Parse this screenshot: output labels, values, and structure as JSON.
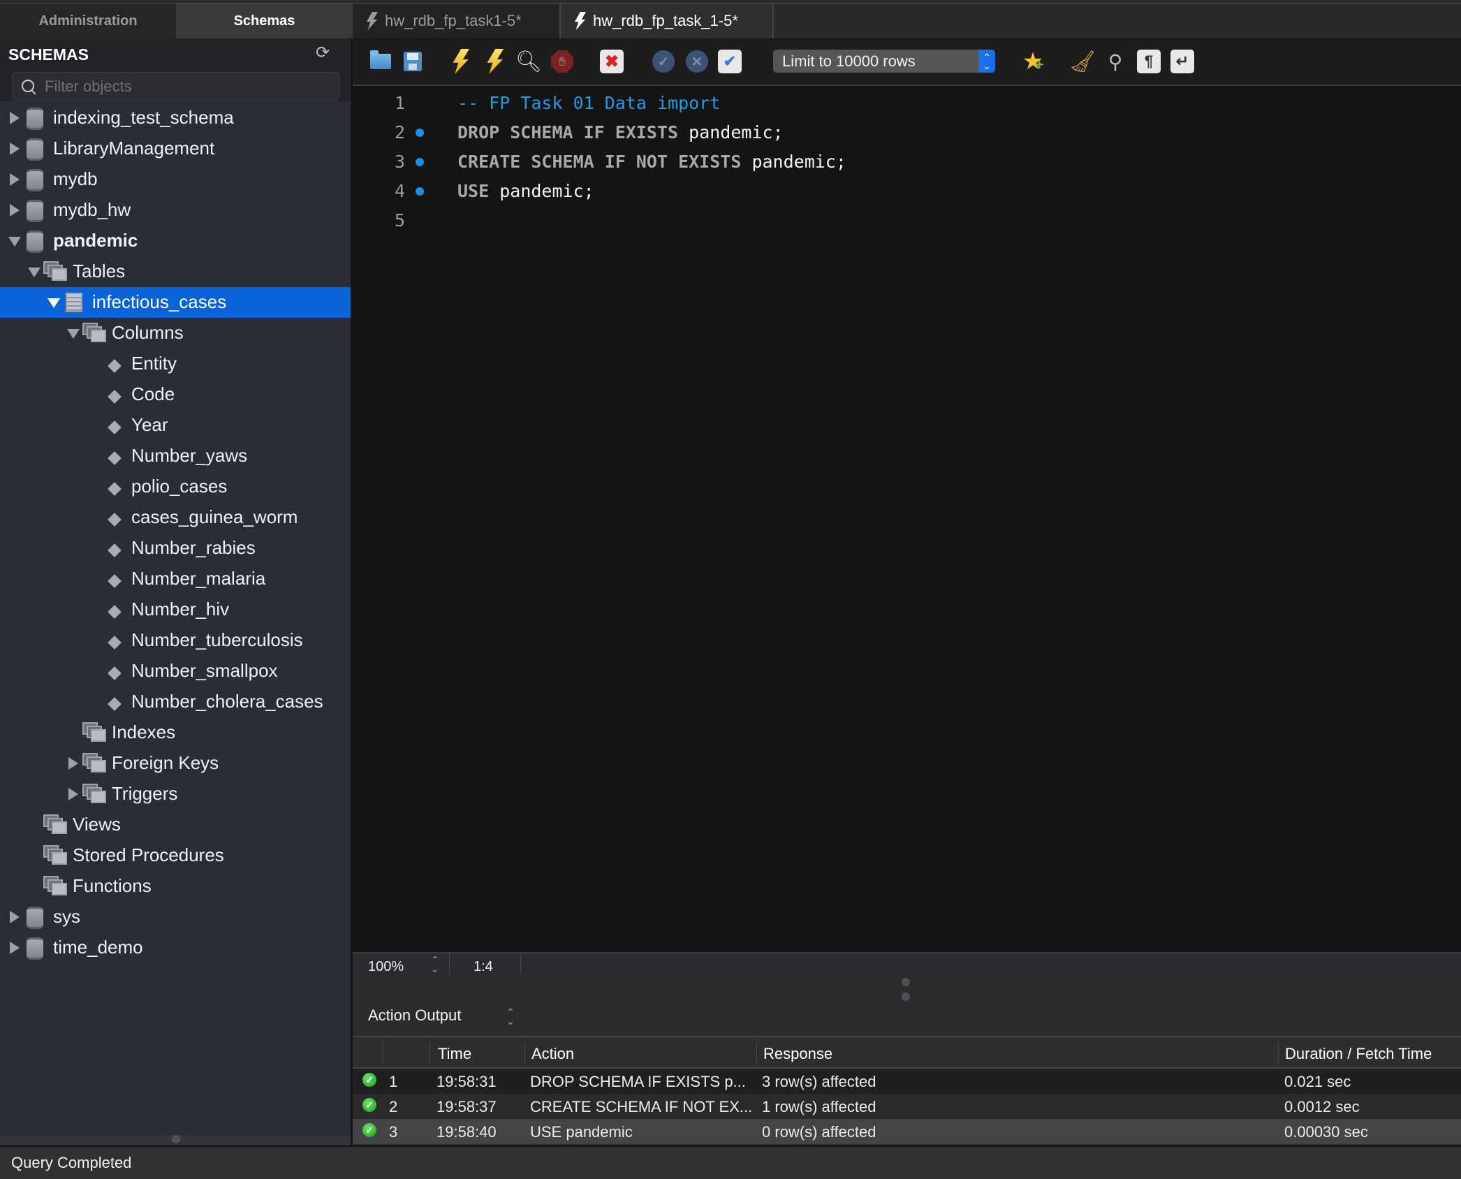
{
  "left_tabs": {
    "administration": "Administration",
    "schemas": "Schemas",
    "active": "Schemas"
  },
  "sidebar": {
    "title": "SCHEMAS",
    "refresh_icon": "refresh-icon",
    "filter": {
      "placeholder": "Filter objects",
      "value": ""
    },
    "tree": [
      {
        "label": "indexing_test_schema",
        "type": "schema",
        "expanded": false,
        "level": 0
      },
      {
        "label": "LibraryManagement",
        "type": "schema",
        "expanded": false,
        "level": 0
      },
      {
        "label": "mydb",
        "type": "schema",
        "expanded": false,
        "level": 0
      },
      {
        "label": "mydb_hw",
        "type": "schema",
        "expanded": false,
        "level": 0
      },
      {
        "label": "pandemic",
        "type": "schema",
        "expanded": true,
        "level": 0,
        "bold": true
      },
      {
        "label": "Tables",
        "type": "group",
        "expanded": true,
        "level": 1
      },
      {
        "label": "infectious_cases",
        "type": "table",
        "expanded": true,
        "level": 2,
        "selected": true
      },
      {
        "label": "Columns",
        "type": "columns",
        "expanded": true,
        "level": 3
      },
      {
        "label": "Entity",
        "type": "column",
        "level": 4
      },
      {
        "label": "Code",
        "type": "column",
        "level": 4
      },
      {
        "label": "Year",
        "type": "column",
        "level": 4
      },
      {
        "label": "Number_yaws",
        "type": "column",
        "level": 4
      },
      {
        "label": "polio_cases",
        "type": "column",
        "level": 4
      },
      {
        "label": "cases_guinea_worm",
        "type": "column",
        "level": 4
      },
      {
        "label": "Number_rabies",
        "type": "column",
        "level": 4
      },
      {
        "label": "Number_malaria",
        "type": "column",
        "level": 4
      },
      {
        "label": "Number_hiv",
        "type": "column",
        "level": 4
      },
      {
        "label": "Number_tuberculosis",
        "type": "column",
        "level": 4
      },
      {
        "label": "Number_smallpox",
        "type": "column",
        "level": 4
      },
      {
        "label": "Number_cholera_cases",
        "type": "column",
        "level": 4
      },
      {
        "label": "Indexes",
        "type": "group",
        "expanded": null,
        "level": 3
      },
      {
        "label": "Foreign Keys",
        "type": "group",
        "expanded": false,
        "level": 3
      },
      {
        "label": "Triggers",
        "type": "group",
        "expanded": false,
        "level": 3
      },
      {
        "label": "Views",
        "type": "group",
        "expanded": null,
        "level": 1
      },
      {
        "label": "Stored Procedures",
        "type": "group",
        "expanded": null,
        "level": 1
      },
      {
        "label": "Functions",
        "type": "group",
        "expanded": null,
        "level": 1
      },
      {
        "label": "sys",
        "type": "schema",
        "expanded": false,
        "level": 0
      },
      {
        "label": "time_demo",
        "type": "schema",
        "expanded": false,
        "level": 0
      }
    ]
  },
  "editor_tabs": [
    {
      "label": "hw_rdb_fp_task1-5*",
      "active": false
    },
    {
      "label": "hw_rdb_fp_task_1-5*",
      "active": true
    }
  ],
  "toolbar": {
    "icons": [
      "open-file-icon",
      "save-icon",
      "execute-icon",
      "execute-current-icon",
      "explain-icon",
      "stop-icon",
      "toggle-stop-on-error-icon",
      "commit-icon",
      "rollback-icon",
      "autocommit-icon",
      "add-snippet-icon",
      "beautify-icon",
      "find-icon",
      "invisible-chars-icon",
      "wrap-lines-icon"
    ],
    "limit_select": {
      "value": "Limit to 10000 rows"
    }
  },
  "editor": {
    "lines": [
      {
        "num": "1",
        "marker": false,
        "tokens": [
          {
            "t": "-- FP Task 01 Data import",
            "c": "cmt"
          }
        ]
      },
      {
        "num": "2",
        "marker": true,
        "tokens": [
          {
            "t": "DROP SCHEMA IF EXISTS ",
            "c": "kw"
          },
          {
            "t": "pandemic;",
            "c": "idf"
          }
        ]
      },
      {
        "num": "3",
        "marker": true,
        "tokens": [
          {
            "t": "CREATE SCHEMA IF NOT EXISTS ",
            "c": "kw"
          },
          {
            "t": "pandemic;",
            "c": "idf"
          }
        ]
      },
      {
        "num": "4",
        "marker": true,
        "tokens": [
          {
            "t": "USE ",
            "c": "kw"
          },
          {
            "t": "pandemic;",
            "c": "idf"
          }
        ]
      },
      {
        "num": "5",
        "marker": false,
        "tokens": []
      }
    ],
    "zoom": "100%",
    "cursor_position": "1:4"
  },
  "output": {
    "title": "Action Output",
    "columns": [
      "",
      "",
      "Time",
      "Action",
      "Response",
      "Duration / Fetch Time"
    ],
    "rows": [
      {
        "status": "success",
        "num": "1",
        "time": "19:58:31",
        "action": "DROP SCHEMA IF EXISTS p...",
        "response": "3 row(s) affected",
        "duration": "0.021 sec"
      },
      {
        "status": "success",
        "num": "2",
        "time": "19:58:37",
        "action": "CREATE SCHEMA IF NOT EX...",
        "response": "1 row(s) affected",
        "duration": "0.0012 sec"
      },
      {
        "status": "success",
        "num": "3",
        "time": "19:58:40",
        "action": "USE pandemic",
        "response": "0 row(s) affected",
        "duration": "0.00030 sec"
      }
    ]
  },
  "statusbar": {
    "text": "Query Completed"
  },
  "colors": {
    "selection": "#0a63d8",
    "comment": "#1c9de6",
    "marker": "#1a8fe8",
    "success": "#1a9a1e"
  }
}
